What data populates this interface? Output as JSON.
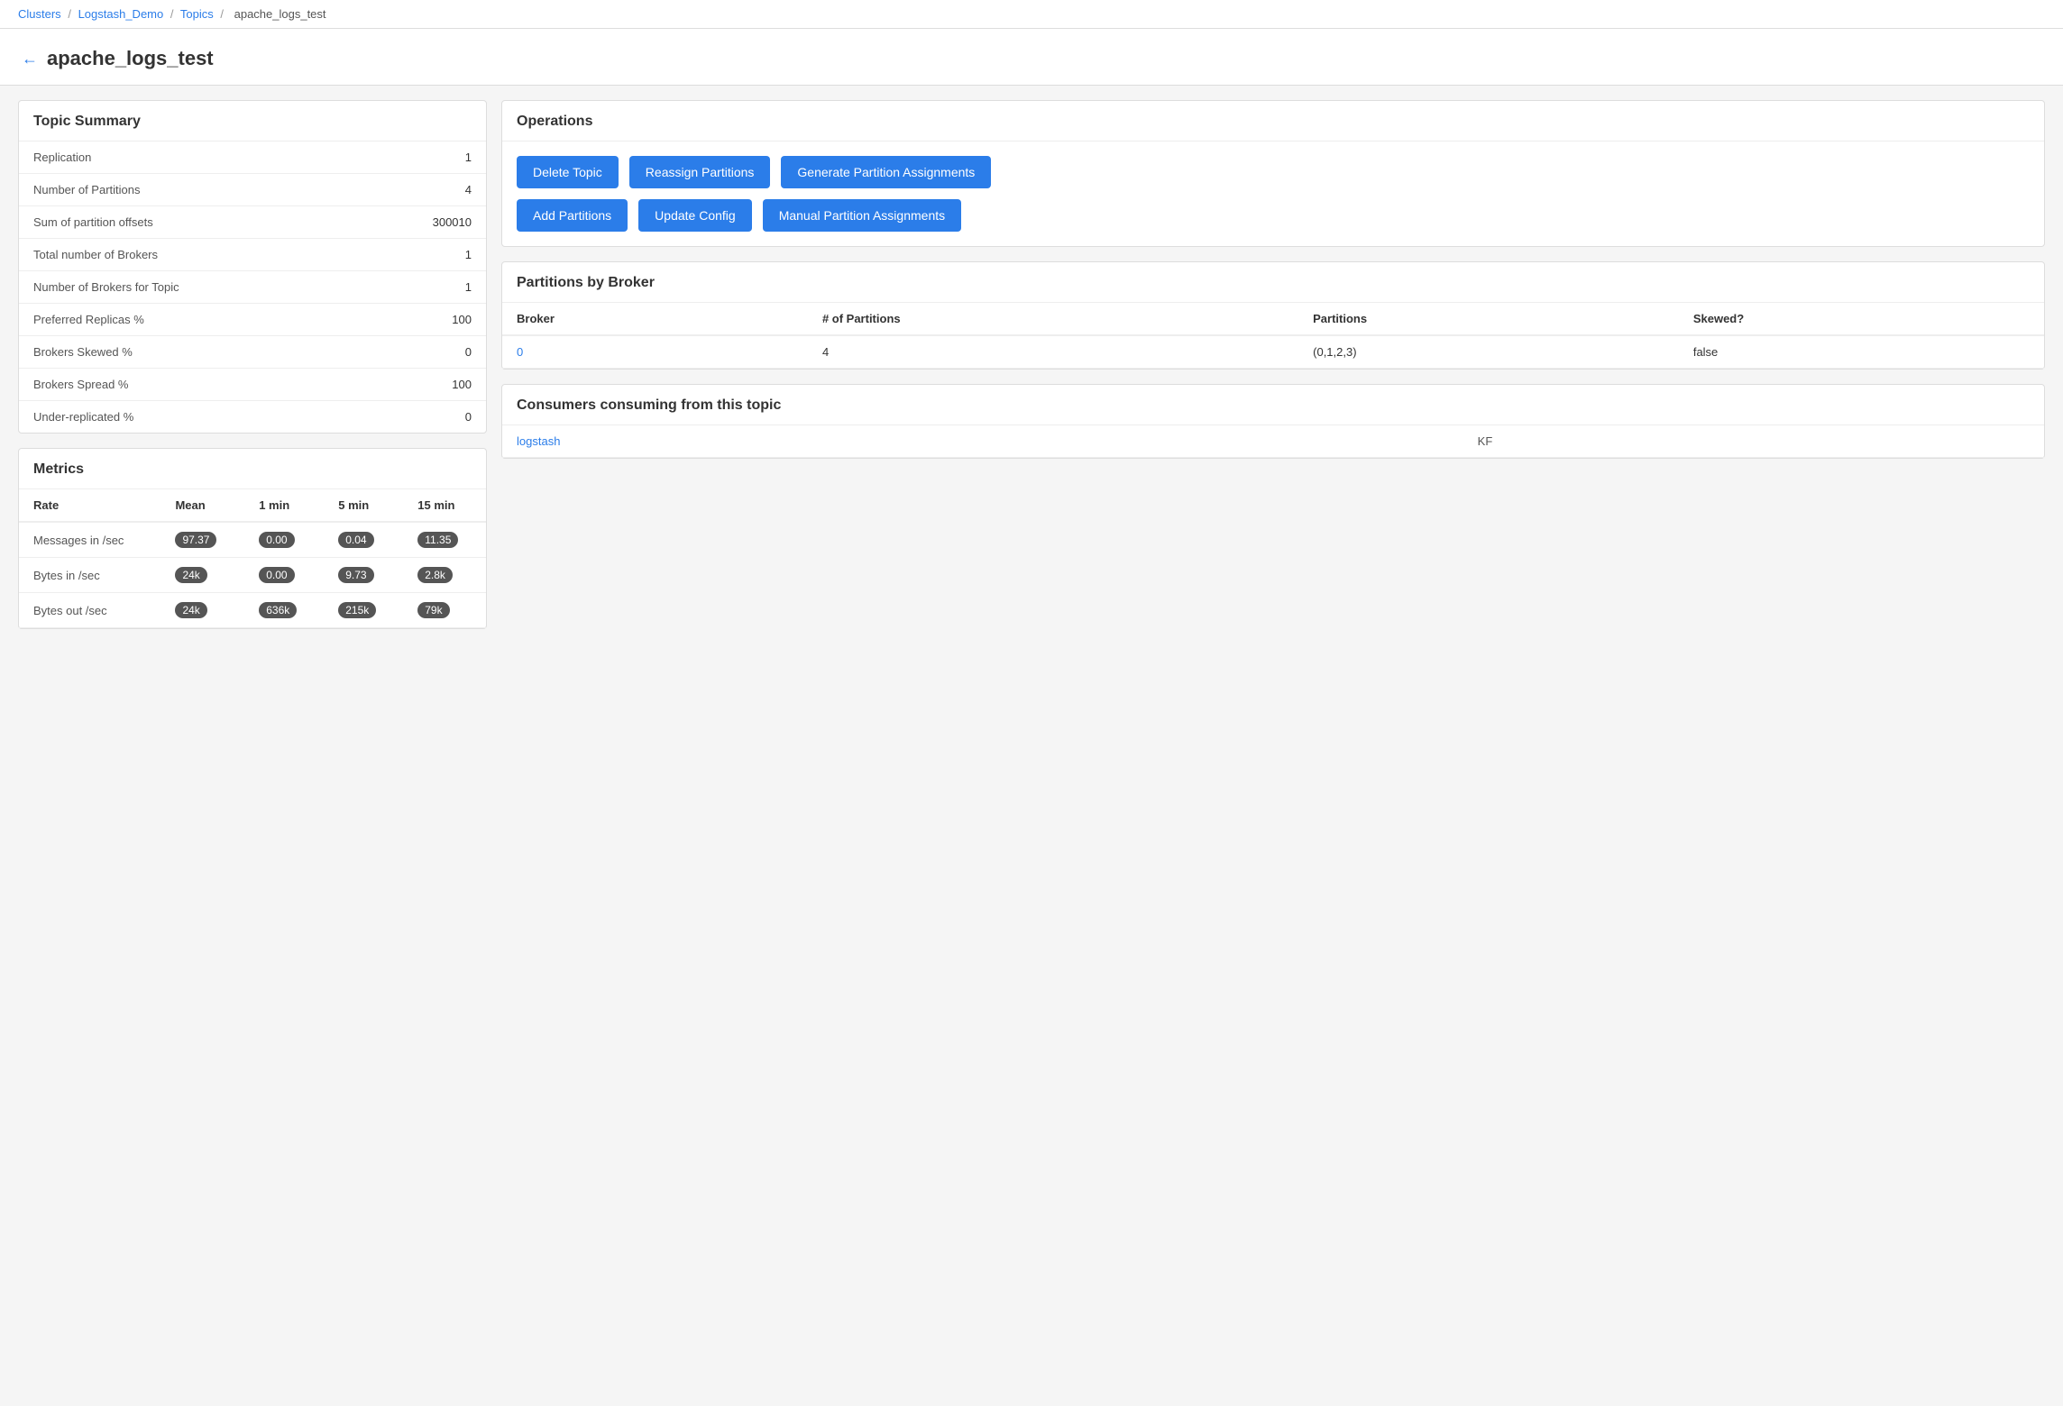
{
  "breadcrumb": {
    "clusters_label": "Clusters",
    "clusters_href": "#",
    "sep1": "/",
    "demo_label": "Logstash_Demo",
    "demo_href": "#",
    "sep2": "/",
    "topics_label": "Topics",
    "topics_href": "#",
    "sep3": "/",
    "current": "apache_logs_test"
  },
  "header": {
    "back_arrow": "←",
    "title": "apache_logs_test"
  },
  "topic_summary": {
    "card_title": "Topic Summary",
    "rows": [
      {
        "label": "Replication",
        "value": "1"
      },
      {
        "label": "Number of Partitions",
        "value": "4"
      },
      {
        "label": "Sum of partition offsets",
        "value": "300010"
      },
      {
        "label": "Total number of Brokers",
        "value": "1"
      },
      {
        "label": "Number of Brokers for Topic",
        "value": "1"
      },
      {
        "label": "Preferred Replicas %",
        "value": "100"
      },
      {
        "label": "Brokers Skewed %",
        "value": "0"
      },
      {
        "label": "Brokers Spread %",
        "value": "100"
      },
      {
        "label": "Under-replicated %",
        "value": "0"
      }
    ]
  },
  "operations": {
    "card_title": "Operations",
    "row1": [
      {
        "label": "Delete Topic",
        "name": "delete-topic-button"
      },
      {
        "label": "Reassign Partitions",
        "name": "reassign-partitions-button"
      },
      {
        "label": "Generate Partition Assignments",
        "name": "generate-partition-assignments-button"
      }
    ],
    "row2": [
      {
        "label": "Add Partitions",
        "name": "add-partitions-button"
      },
      {
        "label": "Update Config",
        "name": "update-config-button"
      },
      {
        "label": "Manual Partition Assignments",
        "name": "manual-partition-assignments-button"
      }
    ]
  },
  "partitions_by_broker": {
    "card_title": "Partitions by Broker",
    "columns": [
      "Broker",
      "# of Partitions",
      "Partitions",
      "Skewed?"
    ],
    "rows": [
      {
        "broker": "0",
        "num_partitions": "4",
        "partitions": "(0,1,2,3)",
        "skewed": "false"
      }
    ]
  },
  "consumers": {
    "card_title": "Consumers consuming from this topic",
    "rows": [
      {
        "name": "logstash",
        "type": "KF"
      }
    ]
  },
  "metrics": {
    "card_title": "Metrics",
    "columns": [
      "Rate",
      "Mean",
      "1 min",
      "5 min",
      "15 min"
    ],
    "rows": [
      {
        "rate": "Messages in /sec",
        "mean": "97.37",
        "min1": "0.00",
        "min5": "0.04",
        "min15": "11.35"
      },
      {
        "rate": "Bytes in /sec",
        "mean": "24k",
        "min1": "0.00",
        "min5": "9.73",
        "min15": "2.8k"
      },
      {
        "rate": "Bytes out /sec",
        "mean": "24k",
        "min1": "636k",
        "min5": "215k",
        "min15": "79k"
      }
    ]
  }
}
